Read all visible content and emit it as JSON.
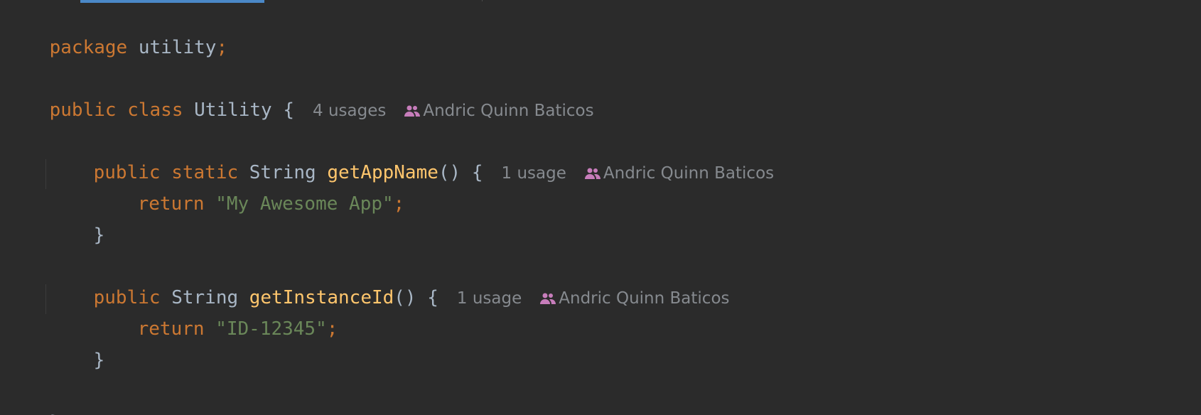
{
  "editor": {
    "tab_accent_color": "#4a88c7",
    "lines": {
      "package_kw": "package",
      "package_name": "utility",
      "package_semi": ";",
      "class_public": "public",
      "class_kw": "class",
      "class_name": "Utility",
      "class_brace": "{",
      "class_usages": "4 usages",
      "class_author": "Andric Quinn Baticos",
      "m1_public": "public",
      "m1_static": "static",
      "m1_type": "String",
      "m1_name": "getAppName",
      "m1_parens": "()",
      "m1_brace": "{",
      "m1_usages": "1 usage",
      "m1_author": "Andric Quinn Baticos",
      "m1_return_kw": "return",
      "m1_return_value": "\"My Awesome App\"",
      "m1_semi": ";",
      "m1_close": "}",
      "m2_public": "public",
      "m2_type": "String",
      "m2_name": "getInstanceId",
      "m2_parens": "()",
      "m2_brace": "{",
      "m2_usages": "1 usage",
      "m2_author": "Andric Quinn Baticos",
      "m2_return_kw": "return",
      "m2_return_value": "\"ID-12345\"",
      "m2_semi": ";",
      "m2_close": "}",
      "class_close": "}"
    },
    "icons": {
      "author": "people-icon"
    },
    "colors": {
      "background": "#2b2b2b",
      "keyword": "#cc7832",
      "method": "#ffc66d",
      "string": "#6a8759",
      "text": "#a9b7c6",
      "hint": "#868a8f",
      "author_icon": "#c77dbb"
    }
  }
}
